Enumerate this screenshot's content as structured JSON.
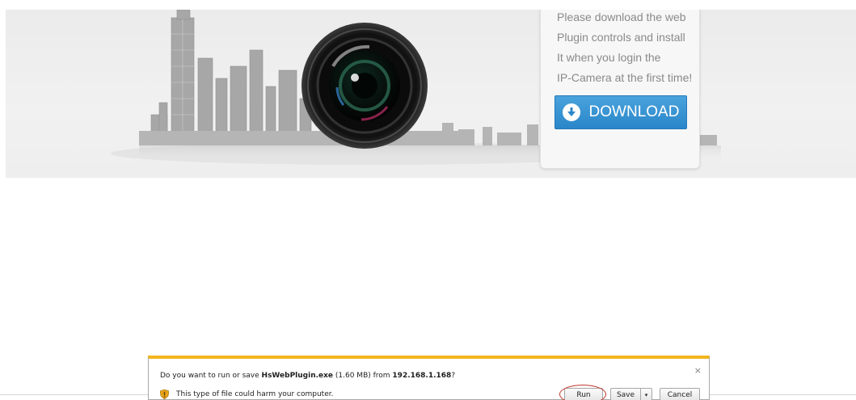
{
  "hero": {
    "info_lines": [
      "Please download the web",
      "Plugin controls and install",
      "It when you login the",
      "IP-Camera at the first time!"
    ],
    "download_label": "DOWNLOAD",
    "download_icon": "arrow-down-circle-icon",
    "accent_color": "#2a86c9"
  },
  "notification_bar": {
    "question_prefix": "Do you want to run or save ",
    "file_name": "HsWebPlugin.exe",
    "file_size": " (1.60 MB) from ",
    "host": "192.168.1.168",
    "question_suffix": "?",
    "warning": "This type of file could harm your computer.",
    "warning_icon": "shield-warning-icon",
    "run_label": "Run",
    "save_label": "Save",
    "save_dropdown_glyph": "▾",
    "cancel_label": "Cancel",
    "close_glyph": "×",
    "accent_color": "#f1b51b"
  }
}
